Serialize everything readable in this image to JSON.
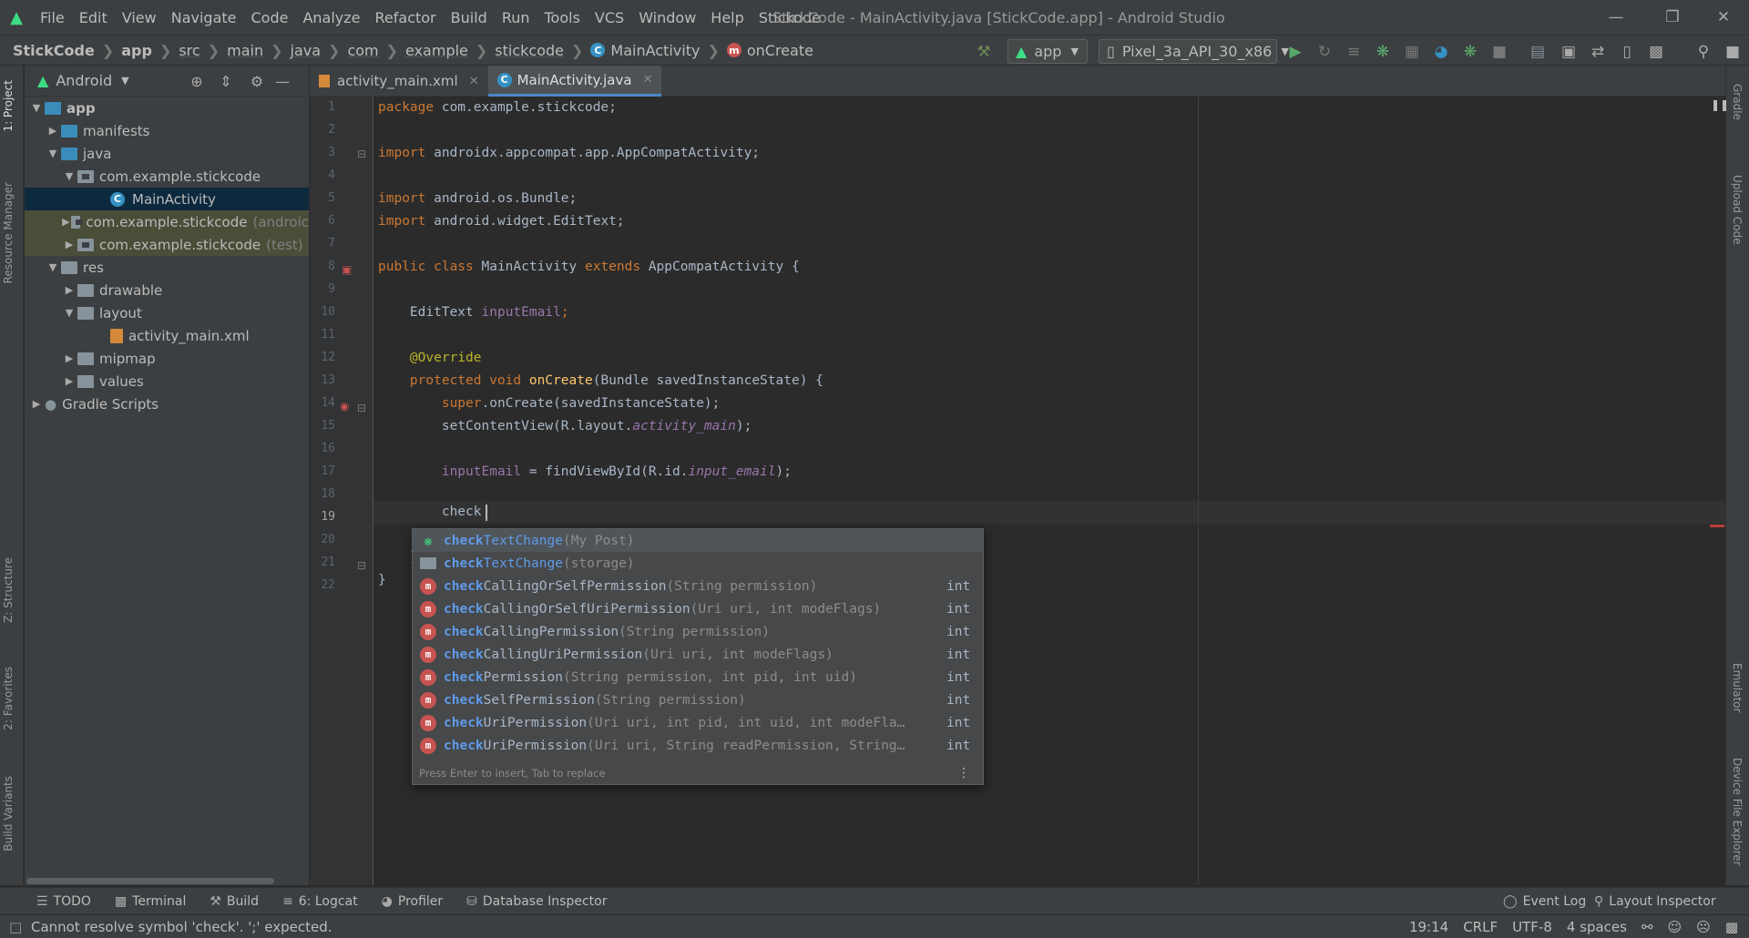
{
  "window": {
    "title": "StickCode - MainActivity.java [StickCode.app] - Android Studio",
    "menu": [
      "File",
      "Edit",
      "View",
      "Navigate",
      "Code",
      "Analyze",
      "Refactor",
      "Build",
      "Run",
      "Tools",
      "VCS",
      "Window",
      "Help",
      "Stickode"
    ]
  },
  "breadcrumb": [
    "StickCode",
    "app",
    "src",
    "main",
    "java",
    "com",
    "example",
    "stickcode",
    "MainActivity",
    "onCreate"
  ],
  "toolbar": {
    "run_config": "app",
    "device": "Pixel_3a_API_30_x86"
  },
  "project_panel": {
    "view_mode": "Android",
    "tree": [
      {
        "label": "app",
        "suffix": ""
      },
      {
        "label": "manifests",
        "suffix": ""
      },
      {
        "label": "java",
        "suffix": ""
      },
      {
        "label": "com.example.stickcode",
        "suffix": ""
      },
      {
        "label": "MainActivity",
        "suffix": ""
      },
      {
        "label": "com.example.stickcode",
        "suffix": "(androic"
      },
      {
        "label": "com.example.stickcode",
        "suffix": "(test)"
      },
      {
        "label": "res",
        "suffix": ""
      },
      {
        "label": "drawable",
        "suffix": ""
      },
      {
        "label": "layout",
        "suffix": ""
      },
      {
        "label": "activity_main.xml",
        "suffix": ""
      },
      {
        "label": "mipmap",
        "suffix": ""
      },
      {
        "label": "values",
        "suffix": ""
      },
      {
        "label": "Gradle Scripts",
        "suffix": ""
      }
    ]
  },
  "left_stripe": [
    "1: Project",
    "Resource Manager",
    "Z: Structure",
    "2: Favorites",
    "Build Variants"
  ],
  "right_stripe": [
    "Gradle",
    "Upload Code",
    "Emulator",
    "Device File Explorer"
  ],
  "editor_tabs": [
    {
      "label": "activity_main.xml",
      "active": false
    },
    {
      "label": "MainActivity.java",
      "active": true
    }
  ],
  "line_numbers": [
    "1",
    "2",
    "3",
    "4",
    "5",
    "6",
    "7",
    "8",
    "9",
    "10",
    "11",
    "12",
    "13",
    "14",
    "15",
    "16",
    "17",
    "18",
    "19",
    "20",
    "21",
    "22"
  ],
  "code": {
    "l1_kw": "package",
    "l1_rest": " com.example.stickcode;",
    "l3_kw": "import",
    "l3_rest": " androidx.appcompat.app.AppCompatActivity;",
    "l5_kw": "import",
    "l5_rest": " android.os.Bundle;",
    "l6_kw": "import",
    "l6_rest": " android.widget.EditText;",
    "l8_kw1": "public class",
    "l8_name": " MainActivity ",
    "l8_kw2": "extends",
    "l8_rest": " AppCompatActivity {",
    "l10_type": "    EditText ",
    "l10_field": "inputEmail",
    "l10_end": ";",
    "l12_ann": "    @Override",
    "l13_kw": "    protected void ",
    "l13_fn": "onCreate",
    "l13_rest": "(Bundle savedInstanceState) {",
    "l14_kw": "        super",
    "l14_rest": ".onCreate(savedInstanceState);",
    "l15_a": "        setContentView(R.layout.",
    "l15_it": "activity_main",
    "l15_b": ");",
    "l17_field": "        inputEmail",
    "l17_a": " = findViewById(R.id.",
    "l17_it": "input_email",
    "l17_b": ");",
    "l19": "        check",
    "l21": "    }",
    "l22": "}"
  },
  "completion": {
    "typed": "check",
    "items": [
      {
        "match": "check",
        "rest": "TextChange",
        "params": "(My Post)",
        "type": "",
        "icon": "android-icon"
      },
      {
        "match": "check",
        "rest": "TextChange",
        "params": "(storage)",
        "type": "",
        "icon": "folder-icon"
      },
      {
        "match": "check",
        "rest": "CallingOrSelfPermission",
        "params": "(String permission)",
        "type": "int",
        "icon": "method-icon"
      },
      {
        "match": "check",
        "rest": "CallingOrSelfUriPermission",
        "params": "(Uri uri, int modeFlags)",
        "type": "int",
        "icon": "method-icon"
      },
      {
        "match": "check",
        "rest": "CallingPermission",
        "params": "(String permission)",
        "type": "int",
        "icon": "method-icon"
      },
      {
        "match": "check",
        "rest": "CallingUriPermission",
        "params": "(Uri uri, int modeFlags)",
        "type": "int",
        "icon": "method-icon"
      },
      {
        "match": "check",
        "rest": "Permission",
        "params": "(String permission, int pid, int uid)",
        "type": "int",
        "icon": "method-icon"
      },
      {
        "match": "check",
        "rest": "SelfPermission",
        "params": "(String permission)",
        "type": "int",
        "icon": "method-icon"
      },
      {
        "match": "check",
        "rest": "UriPermission",
        "params": "(Uri uri, int pid, int uid, int modeFla…",
        "type": "int",
        "icon": "method-icon"
      },
      {
        "match": "check",
        "rest": "UriPermission",
        "params": "(Uri uri, String readPermission, String…",
        "type": "int",
        "icon": "method-icon"
      }
    ],
    "footer": "Press Enter to insert, Tab to replace"
  },
  "bottom_tools": {
    "left": [
      "TODO",
      "Terminal",
      "Build",
      "6: Logcat",
      "Profiler",
      "Database Inspector"
    ],
    "right": [
      "Event Log",
      "Layout Inspector"
    ]
  },
  "status": {
    "message": "Cannot resolve symbol 'check'. ';' expected.",
    "position": "19:14",
    "line_sep": "CRLF",
    "encoding": "UTF-8",
    "indent": "4 spaces"
  },
  "colors": {
    "accent": "#4a88c7",
    "android_green": "#3ddc84",
    "keyword": "#cc7832",
    "error": "#bc3f3c"
  }
}
